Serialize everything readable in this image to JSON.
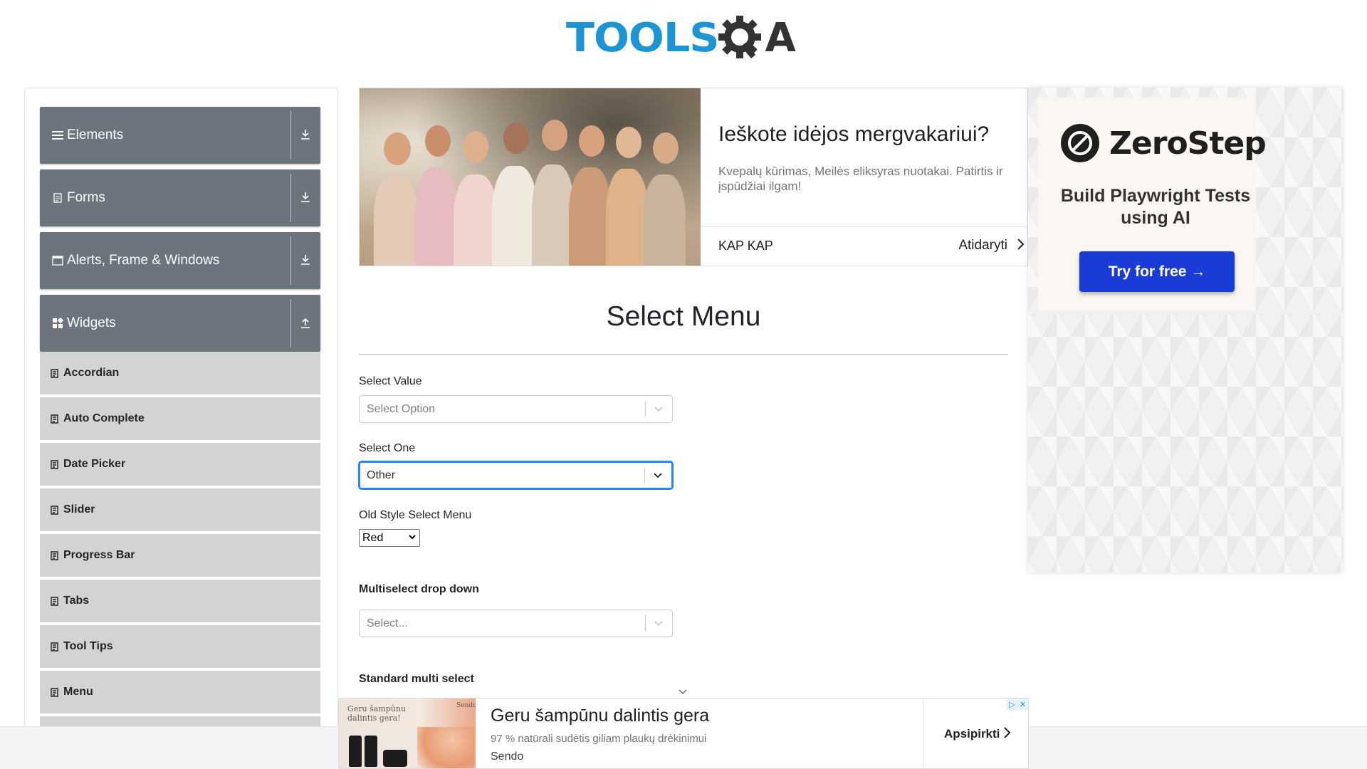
{
  "header": {
    "logo_tools": "TOOLS",
    "logo_qa": "A",
    "logo_icon": "gear-q-icon"
  },
  "sidebar": {
    "groups": [
      {
        "label": "Elements",
        "icon": "hamburger-icon",
        "arrow": "download-arrow-icon"
      },
      {
        "label": "Forms",
        "icon": "form-icon",
        "arrow": "download-arrow-icon"
      },
      {
        "label": "Alerts, Frame & Windows",
        "icon": "window-icon",
        "arrow": "download-arrow-icon"
      },
      {
        "label": "Widgets",
        "icon": "widgets-grid-icon",
        "arrow": "upload-arrow-icon"
      }
    ],
    "items": [
      {
        "label": "Accordian"
      },
      {
        "label": "Auto Complete"
      },
      {
        "label": "Date Picker"
      },
      {
        "label": "Slider"
      },
      {
        "label": "Progress Bar"
      },
      {
        "label": "Tabs"
      },
      {
        "label": "Tool Tips"
      },
      {
        "label": "Menu"
      }
    ]
  },
  "ad_top": {
    "title": "Ieškote idėjos mergvakariui?",
    "description": "Kvepalų kūrimas, Meilės eliksyras nuotakai. Patirtis ir įspūdžiai ilgam!",
    "brand": "KAP KAP",
    "cta": "Atidaryti"
  },
  "ad_right": {
    "brand": "ZeroStep",
    "headline": "Build Playwright Tests using AI",
    "button": "Try for free →",
    "accent": "#1a3bd6"
  },
  "main": {
    "title": "Select Menu",
    "select_value": {
      "label": "Select Value",
      "placeholder": "Select Option"
    },
    "select_one": {
      "label": "Select One",
      "value": "Other"
    },
    "old_style": {
      "label": "Old Style Select Menu",
      "value": "Red"
    },
    "multiselect": {
      "label": "Multiselect drop down",
      "placeholder": "Select..."
    },
    "standard_multi": {
      "label": "Standard multi select"
    }
  },
  "ad_bottom": {
    "image_text": "Geru šampūnu dalintis gera!",
    "image_brand": "Sendo",
    "title": "Geru šampūnu dalintis gera",
    "description": "97 % natūrali sudėtis giliam plaukų drėkinimui",
    "brand": "Sendo",
    "cta": "Apsipirkti"
  },
  "colors": {
    "sidebar_group": "#6c757d",
    "sidebar_item": "#d3d3d3",
    "focus": "#2684ff",
    "logo_blue": "#1d95d4"
  }
}
